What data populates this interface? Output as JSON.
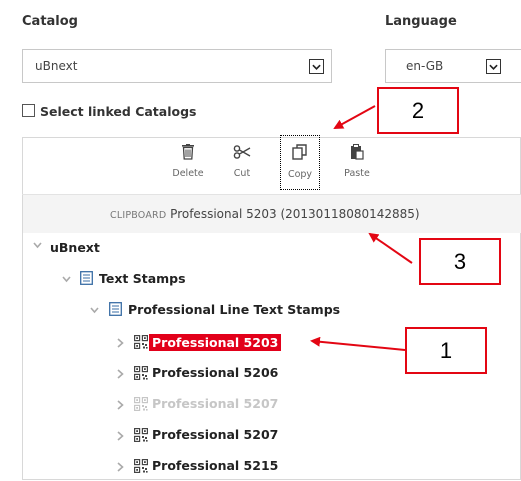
{
  "catalog": {
    "label": "Catalog",
    "value": "uBnext"
  },
  "language": {
    "label": "Language",
    "value": "en-GB"
  },
  "linked": {
    "label": "Select linked Catalogs"
  },
  "toolbar": {
    "delete_label": "Delete",
    "cut_label": "Cut",
    "copy_label": "Copy",
    "paste_label": "Paste"
  },
  "clipboard": {
    "prefix": "CLIPBOARD",
    "text": "Professional 5203 (20130118080142885)"
  },
  "tree": {
    "root": "uBnext",
    "level1": "Text Stamps",
    "level2": "Professional Line Text Stamps",
    "items": [
      {
        "label": "Professional 5203",
        "state": "selected"
      },
      {
        "label": "Professional 5206",
        "state": "normal"
      },
      {
        "label": "Professional 5207",
        "state": "dimmed"
      },
      {
        "label": "Professional 5207",
        "state": "normal"
      },
      {
        "label": "Professional 5215",
        "state": "normal"
      }
    ]
  },
  "callouts": [
    "2",
    "3",
    "1"
  ],
  "colors": {
    "accent": "#e2001a",
    "callout_border": "#e30613"
  }
}
